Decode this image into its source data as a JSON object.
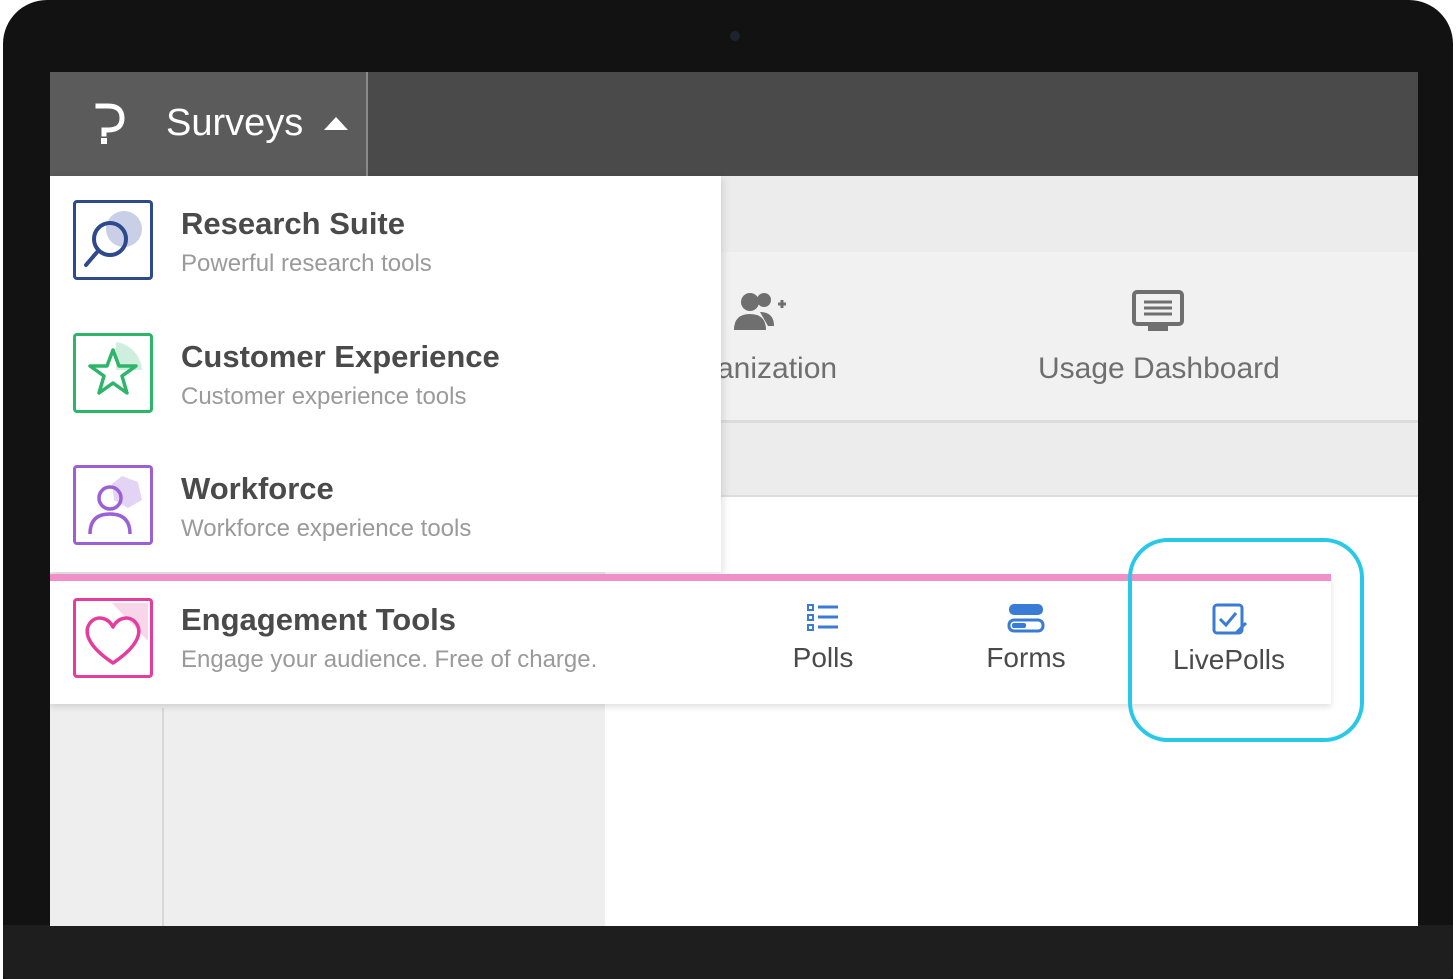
{
  "topbar": {
    "product_label": "Surveys"
  },
  "background": {
    "organization_label": "anization",
    "usage_dashboard_label": "Usage Dashboard"
  },
  "menu": {
    "items": [
      {
        "title": "Research Suite",
        "subtitle": "Powerful research tools",
        "icon": "magnifier-icon",
        "color": "#2c4a8c"
      },
      {
        "title": "Customer Experience",
        "subtitle": "Customer experience tools",
        "icon": "star-icon",
        "color": "#2db56a"
      },
      {
        "title": "Workforce",
        "subtitle": "Workforce experience tools",
        "icon": "person-icon",
        "color": "#9b5fd6"
      },
      {
        "title": "Engagement Tools",
        "subtitle": "Engage your audience. Free of charge.",
        "icon": "heart-icon",
        "color": "#e43d9e"
      }
    ]
  },
  "engagement_tools": [
    {
      "label": "Polls",
      "icon": "list-icon"
    },
    {
      "label": "Forms",
      "icon": "form-icon"
    },
    {
      "label": "LivePolls",
      "icon": "checkbox-edit-icon"
    }
  ],
  "colors": {
    "accent_blue": "#3a7bd5",
    "highlight_cyan": "#28c8e8",
    "engagement_pink": "#ef90c8"
  }
}
